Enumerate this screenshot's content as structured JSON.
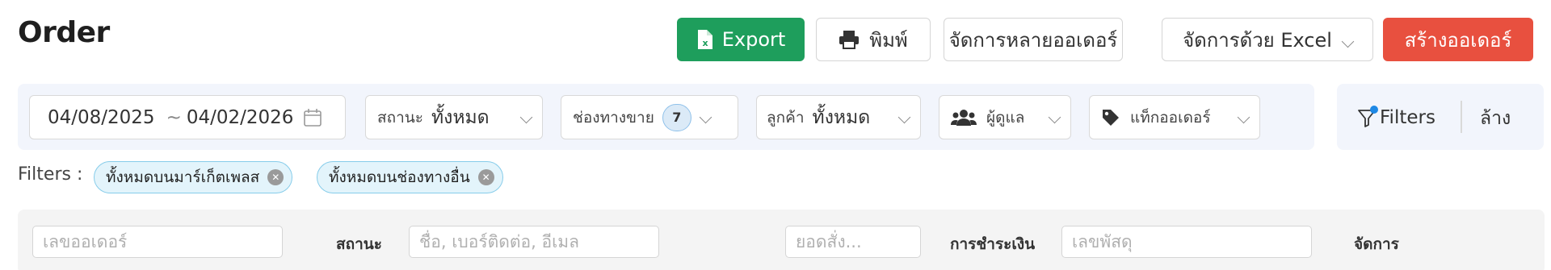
{
  "page": {
    "title": "Order"
  },
  "toolbar": {
    "export_label": "Export",
    "print_label": "พิมพ์",
    "bulk_label": "จัดการหลายออเดอร์",
    "excel_label": "จัดการด้วย Excel",
    "create_label": "สร้างออเดอร์"
  },
  "filters": {
    "date_from": "04/08/2025",
    "date_sep": "~",
    "date_to": "04/02/2026",
    "status_label": "สถานะ",
    "status_value": "ทั้งหมด",
    "channel_label": "ช่องทางขาย",
    "channel_count": "7",
    "customer_label": "ลูกค้า",
    "customer_value": "ทั้งหมด",
    "owner_label": "ผู้ดูแล",
    "tag_label": "แท็กออเดอร์",
    "filters_button": "Filters",
    "clear_button": "ล้าง"
  },
  "active_filters": {
    "label": "Filters :",
    "chips": [
      "ทั้งหมดบนมาร์เก็ตเพลส",
      "ทั้งหมดบนช่องทางอื่น"
    ]
  },
  "table": {
    "order_no_placeholder": "เลขออเดอร์",
    "status_header": "สถานะ",
    "customer_placeholder": "ชื่อ, เบอร์ติดต่อ, อีเมล",
    "amount_placeholder": "ยอดสั่ง...",
    "payment_header": "การชำระเงิน",
    "tracking_placeholder": "เลขพัสดุ",
    "manage_header": "จัดการ"
  },
  "colors": {
    "export": "#1e9e5c",
    "create": "#e8503f",
    "panel": "#f2f5fc",
    "chip": "#e3f4fb",
    "dot": "#1e88e5"
  },
  "icons": [
    "excel-icon",
    "printer-icon",
    "calendar-icon",
    "users-icon",
    "tag-icon",
    "filter-icon",
    "chevron-down-icon",
    "close-circle-icon"
  ]
}
